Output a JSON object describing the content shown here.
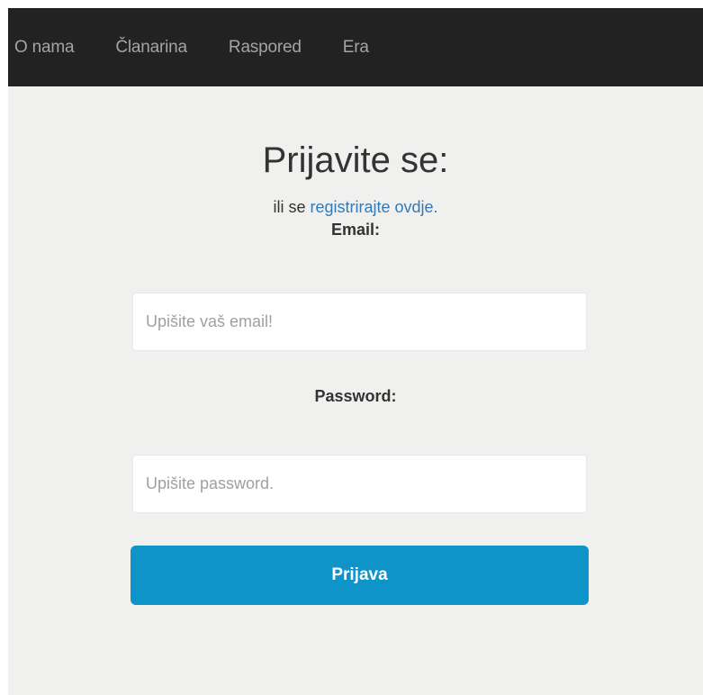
{
  "nav": {
    "items": [
      {
        "label": "O nama"
      },
      {
        "label": "Članarina"
      },
      {
        "label": "Raspored"
      },
      {
        "label": "Era"
      }
    ]
  },
  "login": {
    "title": "Prijavite se:",
    "subtitle_prefix": "ili se ",
    "register_link": "registrirajte ovdje.",
    "email_label": "Email:",
    "email_placeholder": "Upišite vaš email!",
    "email_value": "",
    "password_label": "Password:",
    "password_placeholder": "Upišite password.",
    "password_value": "",
    "submit_label": "Prijava"
  },
  "colors": {
    "navbar_bg": "#222222",
    "page_bg": "#f0f0ee",
    "link": "#337ab7",
    "button_bg": "#0e94c9"
  }
}
